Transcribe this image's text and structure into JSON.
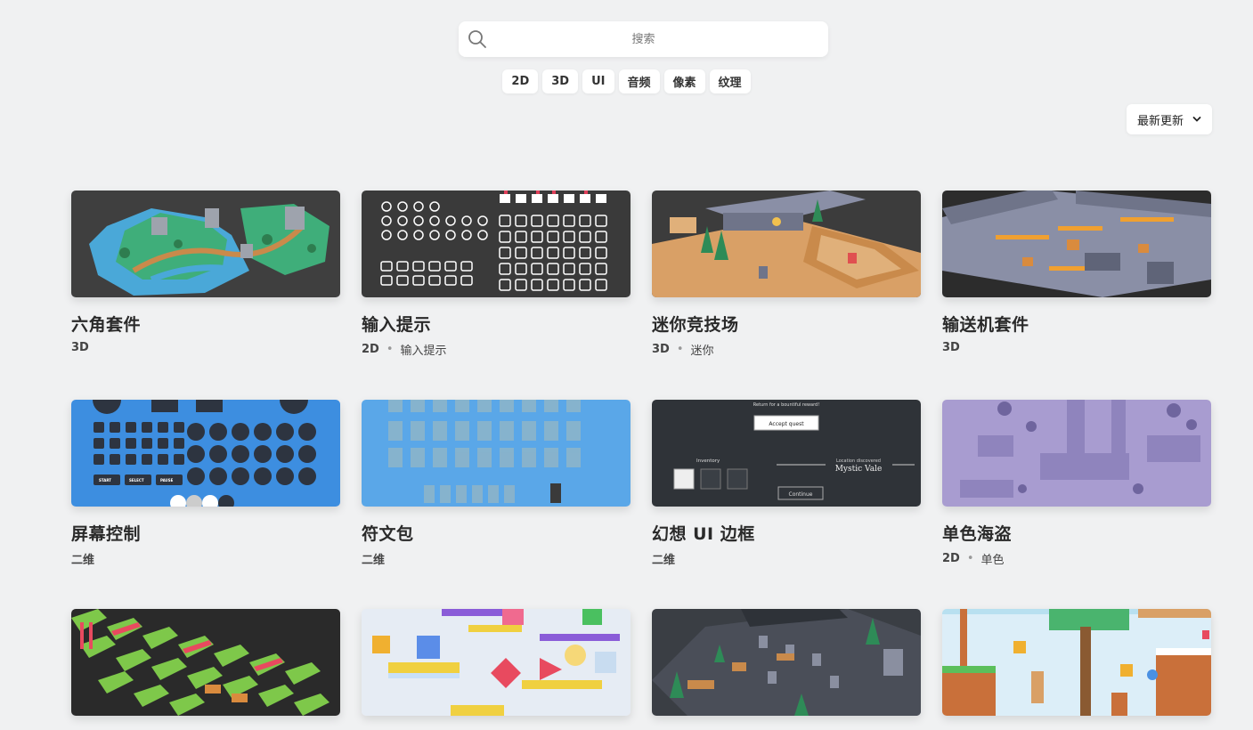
{
  "search": {
    "placeholder": "搜索"
  },
  "tags": [
    "2D",
    "3D",
    "UI",
    "音频",
    "像素",
    "纹理"
  ],
  "sort": {
    "label": "最新更新"
  },
  "cards": [
    {
      "title": "六角套件",
      "tag": "3D",
      "sub": ""
    },
    {
      "title": "输入提示",
      "tag": "2D",
      "sub": "输入提示"
    },
    {
      "title": "迷你竞技场",
      "tag": "3D",
      "sub": "迷你"
    },
    {
      "title": "输送机套件",
      "tag": "3D",
      "sub": ""
    },
    {
      "title": "屏幕控制",
      "tag": "二维",
      "sub": ""
    },
    {
      "title": "符文包",
      "tag": "二维",
      "sub": ""
    },
    {
      "title": "幻想 UI 边框",
      "tag": "二维",
      "sub": ""
    },
    {
      "title": "单色海盗",
      "tag": "2D",
      "sub": "单色"
    },
    {
      "title": "",
      "tag": "",
      "sub": ""
    },
    {
      "title": "",
      "tag": "",
      "sub": ""
    },
    {
      "title": "",
      "tag": "",
      "sub": ""
    },
    {
      "title": "",
      "tag": "",
      "sub": ""
    }
  ],
  "thumb_text": {
    "fantasy_reward": "Return for a bountiful reward!",
    "fantasy_accept": "Accept quest",
    "fantasy_inventory": "Inventory",
    "fantasy_location": "Location discovered",
    "fantasy_place": "Mystic Vale",
    "fantasy_continue": "Continue",
    "controls_start": "START",
    "controls_select": "SELECT",
    "controls_pause": "PAUSE"
  },
  "colors": {
    "background": "#f0f1f2",
    "hex_water": "#4aa8d8",
    "input_bg": "#3a3a3a",
    "arena_sand": "#d9a066",
    "conveyor_floor": "#8a8fa6",
    "controls_blue": "#3d8ee0",
    "runes_blue": "#5aa7e8",
    "fantasy_dark": "#2f3338",
    "pirate_purple": "#a89cd0"
  }
}
